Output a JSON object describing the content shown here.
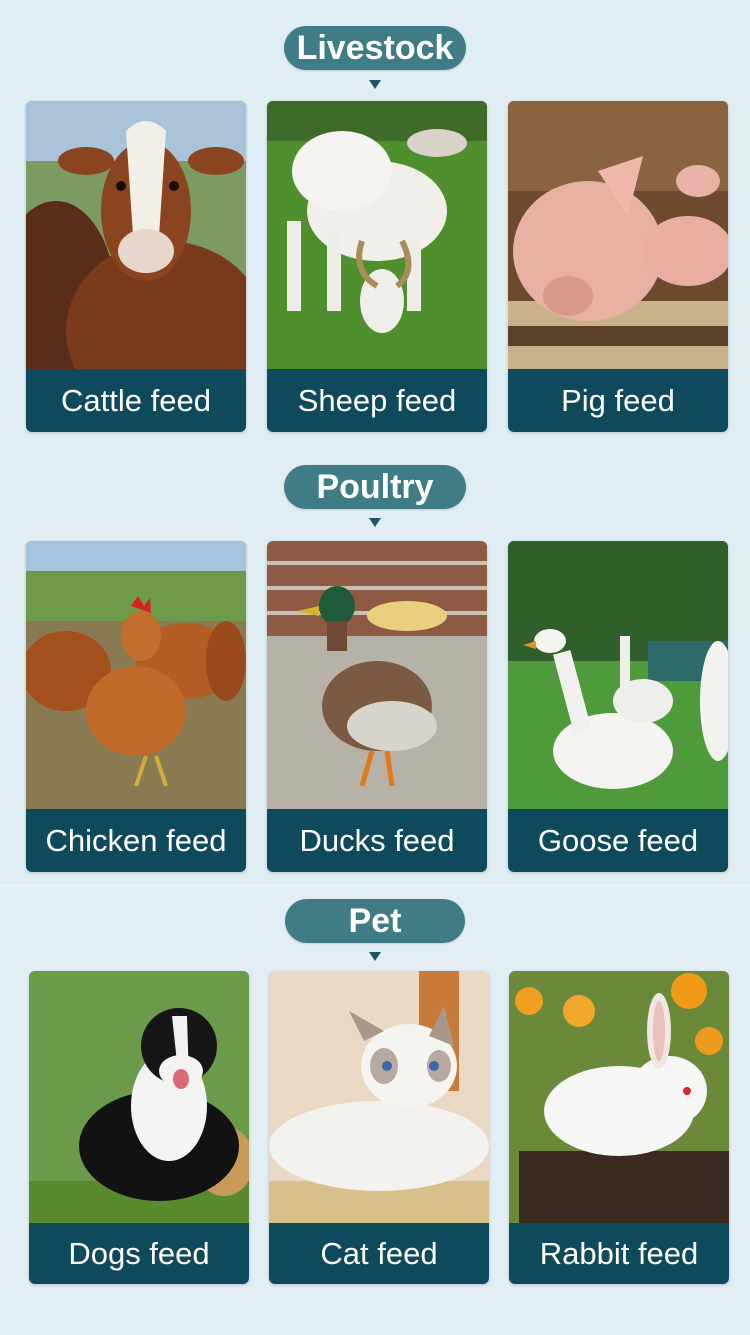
{
  "sections": [
    {
      "title": "Livestock",
      "items": [
        {
          "label": "Cattle feed"
        },
        {
          "label": "Sheep feed"
        },
        {
          "label": "Pig feed"
        }
      ]
    },
    {
      "title": "Poultry",
      "items": [
        {
          "label": "Chicken feed"
        },
        {
          "label": "Ducks feed"
        },
        {
          "label": "Goose feed"
        }
      ]
    },
    {
      "title": "Pet",
      "items": [
        {
          "label": "Dogs feed"
        },
        {
          "label": "Cat feed"
        },
        {
          "label": "Rabbit feed"
        }
      ]
    }
  ],
  "colors": {
    "background": "#e0edf2",
    "pill": "#3f7c86",
    "caption": "#0f4a5c",
    "text": "#ffffff"
  }
}
